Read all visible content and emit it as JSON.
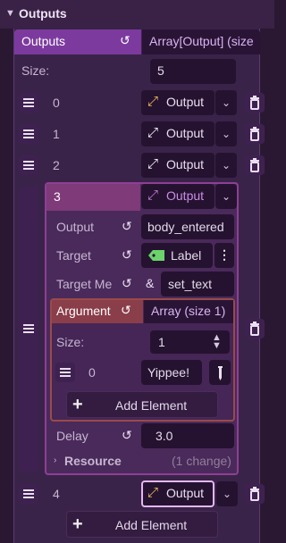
{
  "section": {
    "title": "Outputs",
    "chevron_icon": "chevron-down-icon"
  },
  "outputs_property": {
    "label": "Outputs",
    "value": "Array[Output] (size"
  },
  "size": {
    "label": "Size:",
    "value": "5"
  },
  "items": [
    {
      "index": "0",
      "button": "Output"
    },
    {
      "index": "1",
      "button": "Output"
    },
    {
      "index": "2",
      "button": "Output"
    },
    {
      "index": "3",
      "button": "Output"
    },
    {
      "index": "4",
      "button": "Output"
    }
  ],
  "expanded": {
    "output": {
      "label": "Output",
      "value": "body_entered"
    },
    "target": {
      "label": "Target",
      "value": "Label"
    },
    "target_method": {
      "label": "Target Me",
      "value": "set_text"
    },
    "argument": {
      "label": "Argument",
      "value": "Array (size 1)",
      "size_label": "Size:",
      "size_value": "1",
      "element_index": "0",
      "element_value": "Yippee!",
      "add_label": "Add Element"
    },
    "delay": {
      "label": "Delay",
      "value": "3.0"
    },
    "resource": {
      "label": "Resource",
      "note": "(1 change)"
    }
  },
  "add_element_label": "Add Element",
  "colors": {
    "accent_purple": "#7c3a9e",
    "argument_red": "#8a3e4a",
    "label_tag_green": "#6cd36c",
    "output_icon_orange": "#f0a840"
  }
}
